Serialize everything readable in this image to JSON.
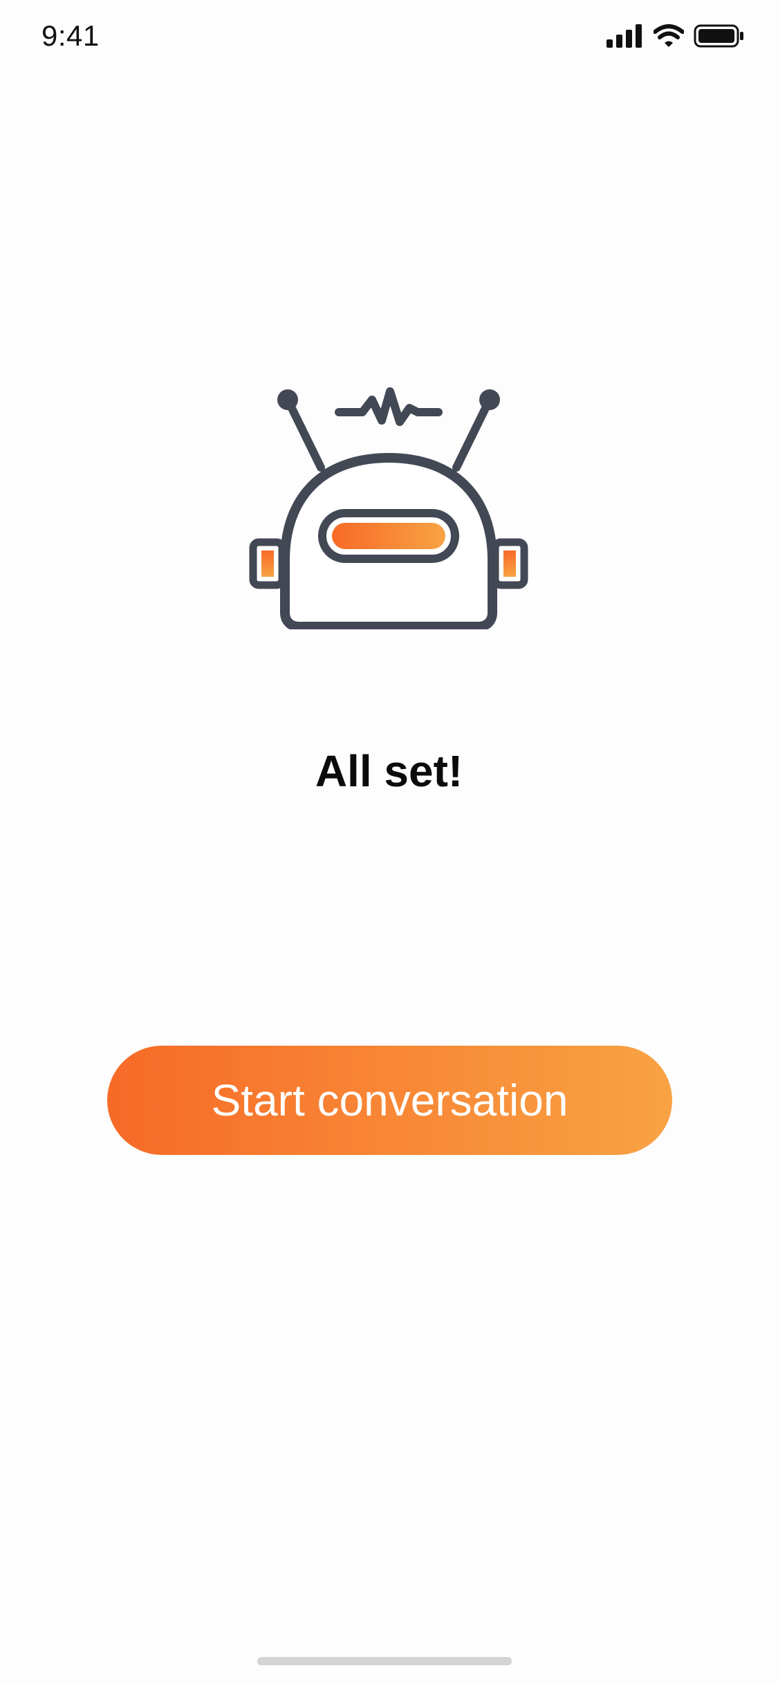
{
  "status_bar": {
    "time": "9:41",
    "icons": [
      "cellular-signal-icon",
      "wifi-icon",
      "battery-icon"
    ]
  },
  "main": {
    "illustration": "robot-icon",
    "headline": "All set!",
    "start_button_label": "Start conversation"
  },
  "colors": {
    "accent_start": "#f76a27",
    "accent_end": "#f8a344",
    "robot_outline": "#434855",
    "background": "#fdfdfd"
  }
}
